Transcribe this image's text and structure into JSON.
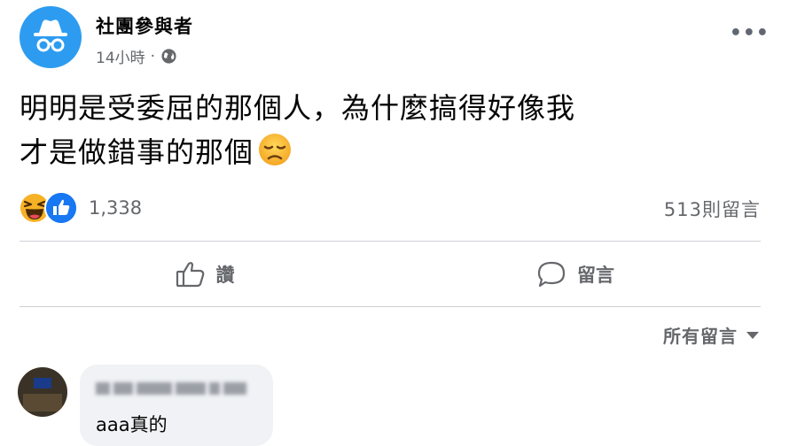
{
  "post": {
    "author": "社團參與者",
    "time": "14小時",
    "separator": "·",
    "privacy_icon": "globe-icon",
    "more_icon": "more-horizontal-icon",
    "more_label": "•••",
    "text_line1": "明明是受委屈的那個人，為什麼搞得好像我",
    "text_line2": "才是做錯事的那個",
    "emoji": "disappointed-face"
  },
  "stats": {
    "reactions": [
      "haha",
      "like"
    ],
    "reaction_count": "1,338",
    "comment_count": "513則留言"
  },
  "actions": {
    "like_label": "讚",
    "comment_label": "留言"
  },
  "comments": {
    "sort_label": "所有留言",
    "items": [
      {
        "author": "",
        "text": "aaa真的"
      }
    ]
  },
  "colors": {
    "accent": "#1877f2",
    "avatar_bg": "#2d9cf0",
    "secondary_text": "#65676b",
    "bubble_bg": "#f0f2f5"
  }
}
